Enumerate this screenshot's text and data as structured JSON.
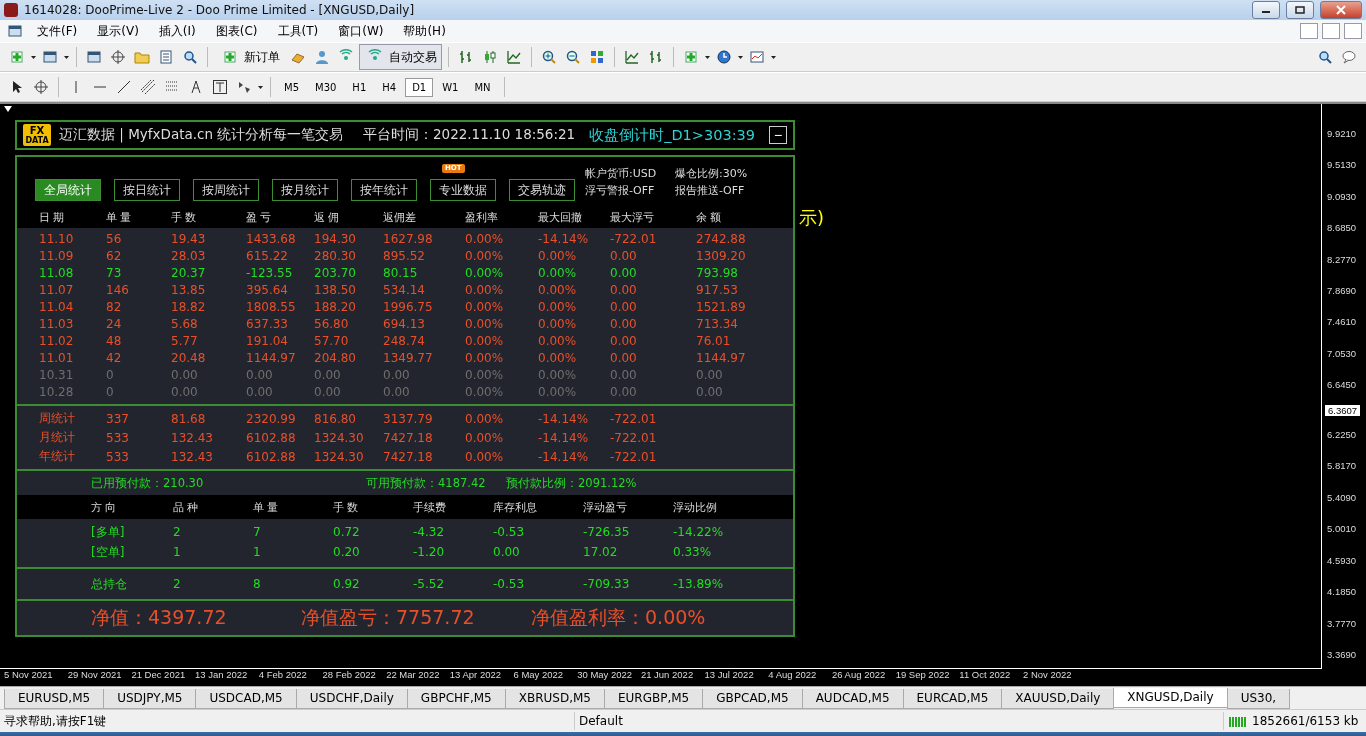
{
  "window": {
    "title": "1614028: DooPrime-Live 2 - Doo Prime Limited - [XNGUSD,Daily]"
  },
  "menu": [
    "文件(F)",
    "显示(V)",
    "插入(I)",
    "图表(C)",
    "工具(T)",
    "窗口(W)",
    "帮助(H)"
  ],
  "toolbar": {
    "new_order": "新订单",
    "auto_trading": {
      "label": "自动交易",
      "on": true
    }
  },
  "timeframes": [
    {
      "label": "M5",
      "selected": false
    },
    {
      "label": "M30",
      "selected": false
    },
    {
      "label": "H1",
      "selected": false
    },
    {
      "label": "H4",
      "selected": false
    },
    {
      "label": "D1",
      "selected": true
    },
    {
      "label": "W1",
      "selected": false
    },
    {
      "label": "MN",
      "selected": false
    }
  ],
  "chart": {
    "hidden_text": "示)",
    "price_axis": [
      "9.9210",
      "9.5130",
      "9.0930",
      "8.6850",
      "8.2770",
      "7.8690",
      "7.4610",
      "7.0530",
      "6.6450",
      "6.2250",
      "5.8170",
      "5.4090",
      "5.0010",
      "4.5930",
      "4.1850",
      "3.7770",
      "3.3690"
    ],
    "current_price": "6.3607",
    "time_axis": [
      "5 Nov 2021",
      "29 Nov 2021",
      "21 Dec 2021",
      "13 Jan 2022",
      "4 Feb 2022",
      "28 Feb 2022",
      "22 Mar 2022",
      "13 Apr 2022",
      "6 May 2022",
      "30 May 2022",
      "21 Jun 2022",
      "13 Jul 2022",
      "4 Aug 2022",
      "26 Aug 2022",
      "19 Sep 2022",
      "11 Oct 2022",
      "2 Nov 2022"
    ]
  },
  "panel": {
    "logo": "FX",
    "logo_sub": "DATA",
    "brand": "迈汇数据 | MyfxData.cn  统计分析每一笔交易",
    "platform_time": "平台时间：2022.11.10 18:56:21",
    "countdown": "收盘倒计时_D1>303:39",
    "collapse": "−",
    "tabs": [
      {
        "label": "全局统计",
        "selected": true,
        "hot": false
      },
      {
        "label": "按日统计",
        "selected": false,
        "hot": false
      },
      {
        "label": "按周统计",
        "selected": false,
        "hot": false
      },
      {
        "label": "按月统计",
        "selected": false,
        "hot": false
      },
      {
        "label": "按年统计",
        "selected": false,
        "hot": false
      },
      {
        "label": "专业数据",
        "selected": false,
        "hot": true
      },
      {
        "label": "交易轨迹",
        "selected": false,
        "hot": false
      }
    ],
    "hot_badge": "HOT",
    "settings": [
      "帐户货币:USD",
      "爆仓比例:30%",
      "浮亏警报-OFF",
      "报告推送-OFF"
    ],
    "columns": [
      "日 期",
      "单 量",
      "手 数",
      "盈 亏",
      "返 佣",
      "返佣差",
      "盈利率",
      "最大回撤",
      "最大浮亏",
      "余 额"
    ],
    "rows": [
      {
        "kind": "profit",
        "cells": [
          "11.10",
          "56",
          "19.43",
          "1433.68",
          "194.30",
          "1627.98",
          "0.00%",
          "-14.14%",
          "-722.01",
          "2742.88"
        ]
      },
      {
        "kind": "profit",
        "cells": [
          "11.09",
          "62",
          "28.03",
          "615.22",
          "280.30",
          "895.52",
          "0.00%",
          "0.00%",
          "0.00",
          "1309.20"
        ]
      },
      {
        "kind": "loss",
        "cells": [
          "11.08",
          "73",
          "20.37",
          "-123.55",
          "203.70",
          "80.15",
          "0.00%",
          "0.00%",
          "0.00",
          "793.98"
        ]
      },
      {
        "kind": "profit",
        "cells": [
          "11.07",
          "146",
          "13.85",
          "395.64",
          "138.50",
          "534.14",
          "0.00%",
          "0.00%",
          "0.00",
          "917.53"
        ]
      },
      {
        "kind": "profit",
        "cells": [
          "11.04",
          "82",
          "18.82",
          "1808.55",
          "188.20",
          "1996.75",
          "0.00%",
          "0.00%",
          "0.00",
          "1521.89"
        ]
      },
      {
        "kind": "profit",
        "cells": [
          "11.03",
          "24",
          "5.68",
          "637.33",
          "56.80",
          "694.13",
          "0.00%",
          "0.00%",
          "0.00",
          "713.34"
        ]
      },
      {
        "kind": "profit",
        "cells": [
          "11.02",
          "48",
          "5.77",
          "191.04",
          "57.70",
          "248.74",
          "0.00%",
          "0.00%",
          "0.00",
          "76.01"
        ]
      },
      {
        "kind": "profit",
        "cells": [
          "11.01",
          "42",
          "20.48",
          "1144.97",
          "204.80",
          "1349.77",
          "0.00%",
          "0.00%",
          "0.00",
          "1144.97"
        ]
      },
      {
        "kind": "empty",
        "cells": [
          "10.31",
          "0",
          "0.00",
          "0.00",
          "0.00",
          "0.00",
          "0.00%",
          "0.00%",
          "0.00",
          "0.00"
        ]
      },
      {
        "kind": "empty",
        "cells": [
          "10.28",
          "0",
          "0.00",
          "0.00",
          "0.00",
          "0.00",
          "0.00%",
          "0.00%",
          "0.00",
          "0.00"
        ]
      }
    ],
    "summary": [
      [
        "周统计",
        "337",
        "81.68",
        "2320.99",
        "816.80",
        "3137.79",
        "0.00%",
        "-14.14%",
        "-722.01"
      ],
      [
        "月统计",
        "533",
        "132.43",
        "6102.88",
        "1324.30",
        "7427.18",
        "0.00%",
        "-14.14%",
        "-722.01"
      ],
      [
        "年统计",
        "533",
        "132.43",
        "6102.88",
        "1324.30",
        "7427.18",
        "0.00%",
        "-14.14%",
        "-722.01"
      ]
    ],
    "margin": [
      "已用预付款：210.30",
      "可用预付款：4187.42",
      "预付款比例：2091.12%"
    ],
    "position_columns": [
      "方 向",
      "品 种",
      "单 量",
      "手 数",
      "手续费",
      "库存利息",
      "浮动盈亏",
      "浮动比例"
    ],
    "positions": [
      [
        "[多单]",
        "2",
        "7",
        "0.72",
        "-4.32",
        "-0.53",
        "-726.35",
        "-14.22%"
      ],
      [
        "[空单]",
        "1",
        "1",
        "0.20",
        "-1.20",
        "0.00",
        "17.02",
        "0.33%"
      ]
    ],
    "total": [
      "总持仓",
      "2",
      "8",
      "0.92",
      "-5.52",
      "-0.53",
      "-709.33",
      "-13.89%"
    ],
    "equity": [
      "净值：4397.72",
      "净值盈亏：7757.72",
      "净值盈利率：0.00%"
    ]
  },
  "symbol_tabs": [
    {
      "label": "EURUSD,M5",
      "selected": false
    },
    {
      "label": "USDJPY,M5",
      "selected": false
    },
    {
      "label": "USDCAD,M5",
      "selected": false
    },
    {
      "label": "USDCHF,Daily",
      "selected": false
    },
    {
      "label": "GBPCHF,M5",
      "selected": false
    },
    {
      "label": "XBRUSD,M5",
      "selected": false
    },
    {
      "label": "EURGBP,M5",
      "selected": false
    },
    {
      "label": "GBPCAD,M5",
      "selected": false
    },
    {
      "label": "AUDCAD,M5",
      "selected": false
    },
    {
      "label": "EURCAD,M5",
      "selected": false
    },
    {
      "label": "XAUUSD,Daily",
      "selected": false
    },
    {
      "label": "XNGUSD,Daily",
      "selected": true
    },
    {
      "label": "US30,",
      "selected": false
    }
  ],
  "status_bar": {
    "help": "寻求帮助,请按F1键",
    "profile": "Default",
    "traffic": "1852661/6153 kb"
  }
}
